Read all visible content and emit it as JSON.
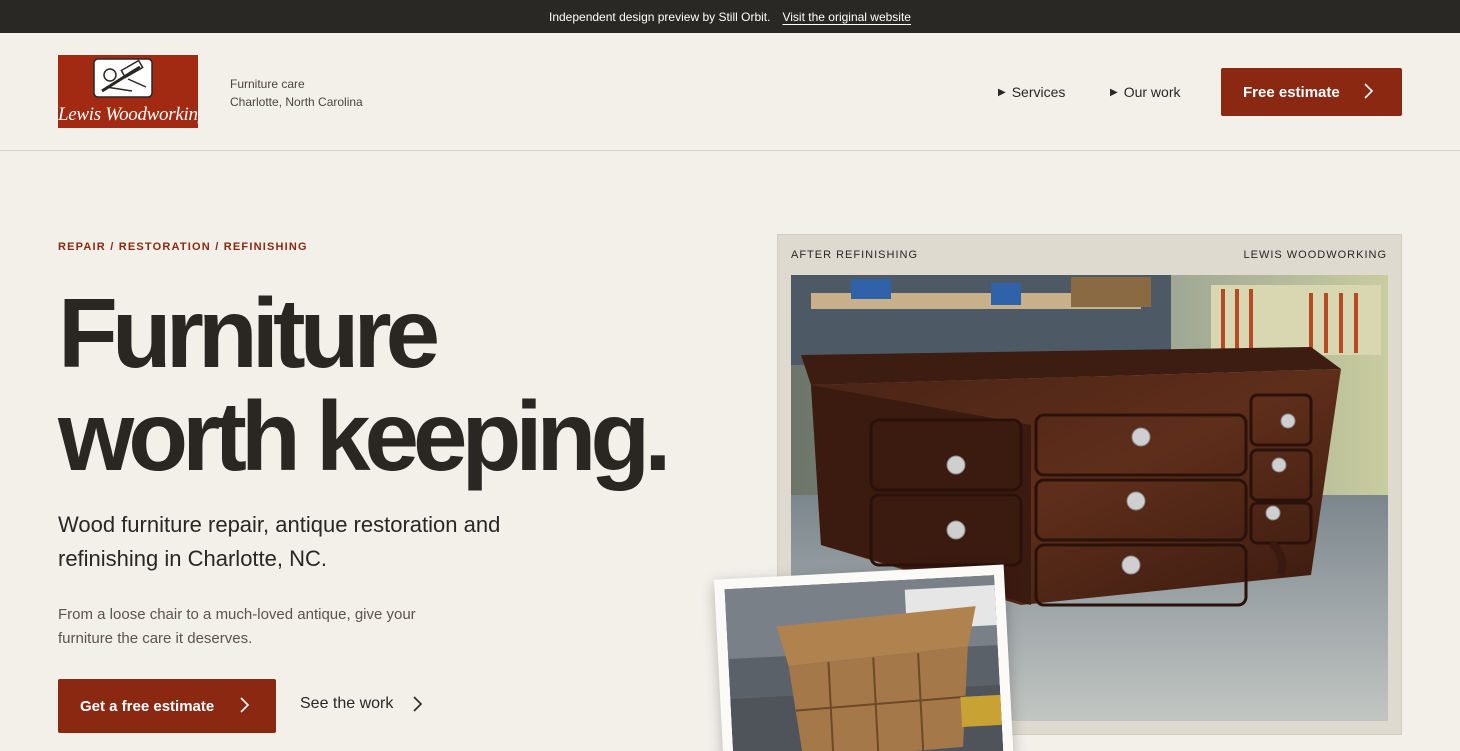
{
  "banner": {
    "text": "Independent design preview by Still Orbit.",
    "link": "Visit the original website"
  },
  "header": {
    "logo_text": "Lewis Woodworking",
    "tagline_line1": "Furniture care",
    "tagline_line2": "Charlotte, North Carolina",
    "nav": [
      {
        "label": "Services"
      },
      {
        "label": "Our work"
      }
    ],
    "cta_label": "Free estimate"
  },
  "hero": {
    "eyebrow": "REPAIR / RESTORATION / REFINISHING",
    "headline_line1": "Furniture",
    "headline_line2": "worth keeping.",
    "subhead": "Wood furniture repair, antique restoration and refinishing in Charlotte, NC.",
    "body": "From a loose chair to a much-loved antique, give your furniture the care it deserves.",
    "primary_cta": "Get a free estimate",
    "secondary_cta": "See the work"
  },
  "feature_card": {
    "label_left": "AFTER REFINISHING",
    "label_right": "LEWIS WOODWORKING"
  },
  "colors": {
    "accent": "#8b2812",
    "background": "#f3f0ea",
    "topbar": "#2a2824",
    "card": "#dedad0"
  },
  "icons": {
    "nav_marker": "triangle-right-icon",
    "button_chevron": "chevron-right-icon"
  }
}
